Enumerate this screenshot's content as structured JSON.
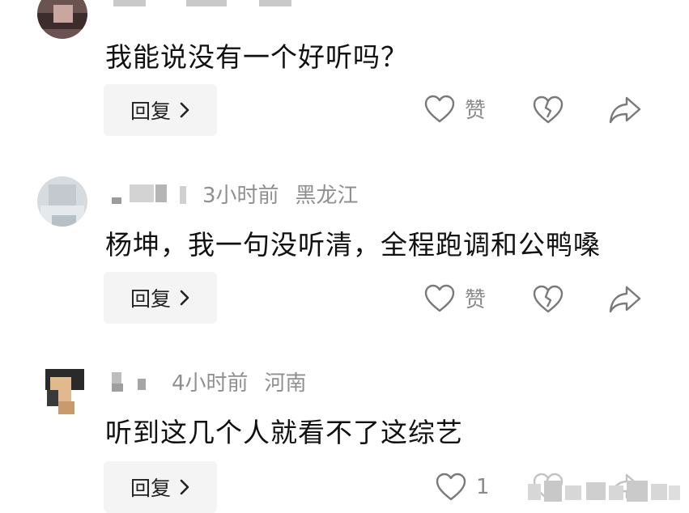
{
  "comments": [
    {
      "time": "",
      "location": "",
      "text": "我能说没有一个好听吗？",
      "reply_label": "回复",
      "like_label": "赞"
    },
    {
      "time": "3小时前",
      "location": "黑龙江",
      "text": "杨坤，我一句没听清，全程跑调和公鸭嗓",
      "reply_label": "回复",
      "like_label": "赞"
    },
    {
      "time": "4小时前",
      "location": "河南",
      "text": "听到这几个人就看不了这综艺",
      "reply_label": "回复",
      "like_label": "1"
    }
  ],
  "icons": {
    "like": "heart-outline-icon",
    "dislike": "broken-heart-icon",
    "share": "share-arrow-icon",
    "chevron": "chevron-right-icon"
  },
  "colors": {
    "text": "#111111",
    "meta": "#8f8f8f",
    "reply_bg": "#f4f4f4",
    "icon": "#7a7a7a"
  }
}
